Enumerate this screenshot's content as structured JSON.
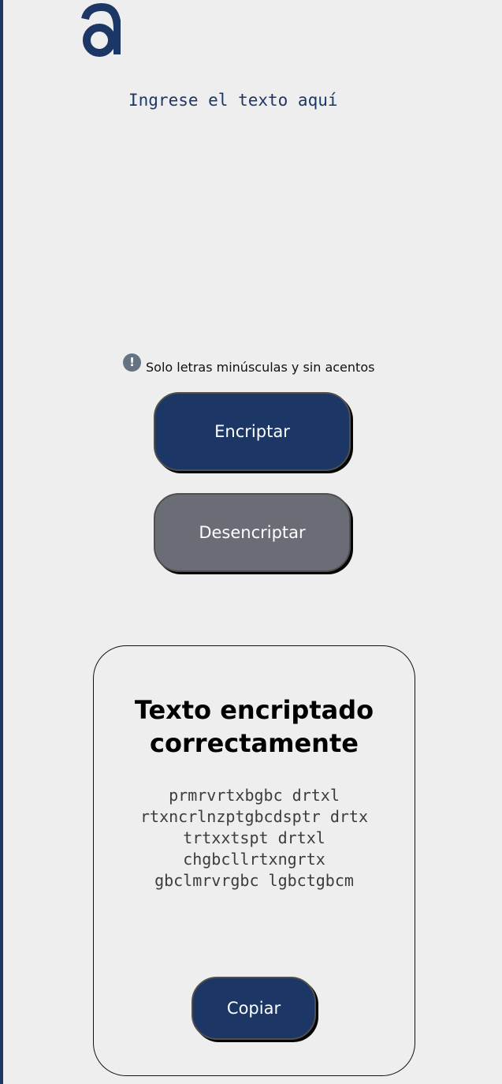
{
  "brand": {
    "logo_icon": "alura-a-logo-icon",
    "color": "#1c3766"
  },
  "input": {
    "placeholder": "Ingrese el texto aquí",
    "value": ""
  },
  "hint": {
    "icon": "exclamation-circle-icon",
    "text": "Solo letras minúsculas y sin acentos"
  },
  "actions": {
    "encrypt_label": "Encriptar",
    "decrypt_label": "Desencriptar"
  },
  "result": {
    "title": "Texto encriptado correctamente",
    "text": "prmrvrtxbgbc drtxl\nrtxncrlnzptgbcdsptr drtx\ntrtxxtspt drtxl\nchgbcllrtxngrtx\ngbclmrvrgbc lgbctgbcm",
    "copy_label": "Copiar"
  },
  "colors": {
    "primary": "#1c3766",
    "secondary": "#6a6d75",
    "background": "#eeeeee"
  }
}
